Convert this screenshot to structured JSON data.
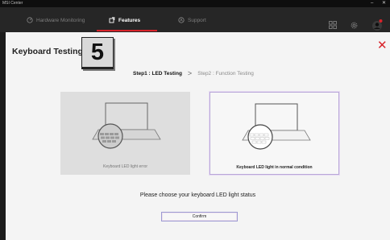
{
  "app": {
    "title": "MSI Center"
  },
  "window": {
    "minimize_glyph": "–",
    "close_glyph": "✕"
  },
  "nav": {
    "tabs": [
      {
        "label": "Hardware Monitoring",
        "icon": "gauge-icon",
        "active": false
      },
      {
        "label": "Features",
        "icon": "features-icon",
        "active": true
      },
      {
        "label": "Support",
        "icon": "support-icon",
        "active": false
      }
    ],
    "right_icons": [
      "grid-icon",
      "gear-icon",
      "avatar"
    ]
  },
  "page": {
    "title": "Keyboard Testing",
    "step_number": "5",
    "close_glyph": "✕",
    "steps": {
      "current": "Step1 : LED Testing",
      "separator": ">",
      "next": "Step2 : Function Testing"
    }
  },
  "options": [
    {
      "label": "Keyboard LED light error",
      "state": "error",
      "selected": false
    },
    {
      "label": "Keyboard LED light in normal condition",
      "state": "normal",
      "selected": true
    }
  ],
  "prompt": "Please choose your keyboard LED light status",
  "confirm_label": "Confirm",
  "colors": {
    "accent": "#d8232a",
    "selection_border": "#b9a7d8",
    "background": "#f4f4f4"
  }
}
